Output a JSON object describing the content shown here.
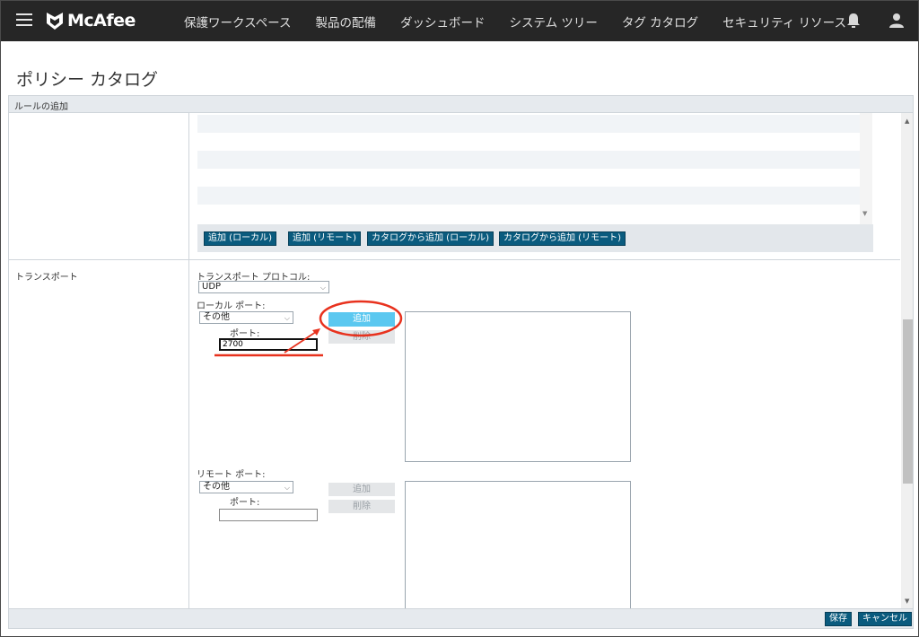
{
  "header": {
    "brand": "McAfee",
    "nav": [
      "保護ワークスペース",
      "製品の配備",
      "ダッシュボード",
      "システム ツリー",
      "タグ カタログ",
      "セキュリティ リソース"
    ],
    "icons": [
      "bell-icon",
      "user-icon"
    ]
  },
  "page": {
    "title": "ポリシー カタログ"
  },
  "section": {
    "header": "ルールの追加"
  },
  "rules_list": {
    "buttons": [
      "追加 (ローカル)",
      "追加 (リモート)",
      "カタログから追加 (ローカル)",
      "カタログから追加 (リモート)"
    ]
  },
  "transport": {
    "row_label": "トランスポート",
    "protocol_label": "トランスポート プロトコル:",
    "protocol_value": "UDP",
    "local": {
      "label": "ローカル ポート:",
      "type_value": "その他",
      "port_label": "ポート:",
      "port_value": "2700",
      "add_label": "追加",
      "remove_label": "削除"
    },
    "remote": {
      "label": "リモート ポート:",
      "type_value": "その他",
      "port_label": "ポート:",
      "port_value": "",
      "add_label": "追加",
      "remove_label": "削除"
    }
  },
  "footer": {
    "save_label": "保存",
    "cancel_label": "キャンセル"
  },
  "colors": {
    "topbar": "#262626",
    "primary_button": "#0a5b7e",
    "highlight_button": "#5bc8f0",
    "annotation": "#e8321e"
  }
}
